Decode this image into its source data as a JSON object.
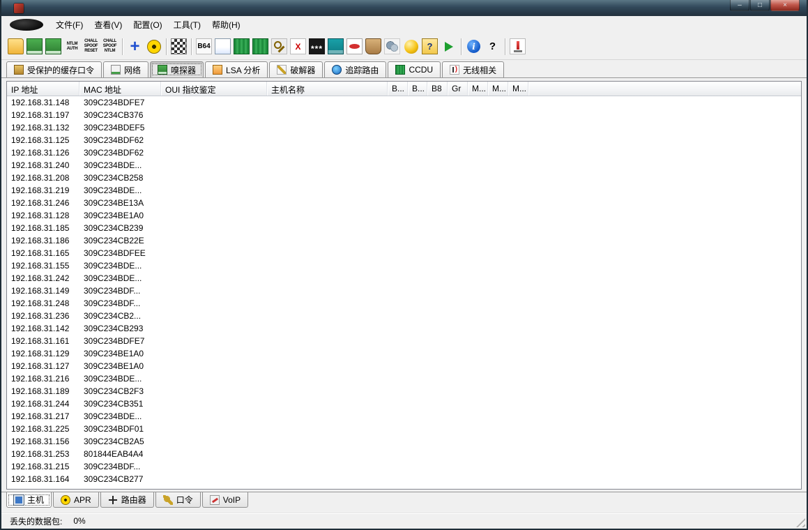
{
  "menubar": {
    "items": [
      "文件(F)",
      "查看(V)",
      "配置(O)",
      "工具(T)",
      "帮助(H)"
    ]
  },
  "toolbar": {
    "items": [
      {
        "name": "open-file",
        "type": "folder"
      },
      {
        "name": "start-stop-sniffer",
        "type": "nic"
      },
      {
        "name": "sniffer-options",
        "type": "nic"
      },
      {
        "name": "ntlm-auth",
        "type": "tinytext",
        "text": "NTLM\nAUTH"
      },
      {
        "name": "chall-spoof-reset",
        "type": "tinytext",
        "text": "CHALL\nSPOOF\nRESET"
      },
      {
        "name": "chall-spoof-ntlm",
        "type": "tinytext",
        "text": "CHALL\nSPOOF\nNTLM"
      },
      {
        "type": "sep"
      },
      {
        "name": "add-to-list",
        "type": "plus",
        "text": "+"
      },
      {
        "name": "start-stop-apr",
        "type": "radiation"
      },
      {
        "type": "sep"
      },
      {
        "name": "filter-grid",
        "type": "grid"
      },
      {
        "type": "sep"
      },
      {
        "name": "base64-decoder",
        "type": "b64",
        "text": "B64"
      },
      {
        "name": "file-editor",
        "type": "page"
      },
      {
        "name": "hash-calculator",
        "type": "hex"
      },
      {
        "name": "hash-calculator-2",
        "type": "hex"
      },
      {
        "name": "rsa-key",
        "type": "key"
      },
      {
        "name": "certificate-x",
        "type": "xc",
        "text": "X"
      },
      {
        "name": "asterisk-revealer",
        "type": "stars",
        "text": "***"
      },
      {
        "name": "calculator",
        "type": "calc"
      },
      {
        "name": "securid-token",
        "type": "securid"
      },
      {
        "name": "wallet",
        "type": "purse"
      },
      {
        "name": "services",
        "type": "gears"
      },
      {
        "name": "remote-sphere",
        "type": "sphere"
      },
      {
        "name": "wizard",
        "type": "wizard",
        "text": "?"
      },
      {
        "name": "audio-player",
        "type": "speaker"
      },
      {
        "type": "sep"
      },
      {
        "name": "info",
        "type": "info",
        "text": "i"
      },
      {
        "name": "help",
        "type": "help",
        "text": "?"
      },
      {
        "type": "sep"
      },
      {
        "name": "abel-injector",
        "type": "injector"
      }
    ]
  },
  "mode_tabs": [
    {
      "name": "protected-storage",
      "icon": "protected-storage-icon",
      "label": "受保护的缓存口令",
      "active": false
    },
    {
      "name": "network",
      "icon": "network-icon",
      "label": "网络",
      "active": false
    },
    {
      "name": "sniffer",
      "icon": "sniffer-icon",
      "label": "嗅探器",
      "active": true
    },
    {
      "name": "lsa-secrets",
      "icon": "lsa-secrets-icon",
      "label": "LSA 分析",
      "active": false
    },
    {
      "name": "cracker",
      "icon": "cracker-icon",
      "label": "破解器",
      "active": false
    },
    {
      "name": "traceroute",
      "icon": "traceroute-icon",
      "label": "追踪路由",
      "active": false
    },
    {
      "name": "ccdu",
      "icon": "ccdu-icon",
      "label": "CCDU",
      "active": false
    },
    {
      "name": "wireless",
      "icon": "wireless-icon",
      "label": "无线相关",
      "active": false
    }
  ],
  "table": {
    "columns": [
      "IP 地址",
      "MAC 地址",
      "OUI 指纹鉴定",
      "主机名称",
      "B...",
      "B...",
      "B8",
      "Gr",
      "M...",
      "M...",
      "M..."
    ],
    "rows": [
      {
        "ip": "192.168.31.148",
        "mac": "309C234BDFE7"
      },
      {
        "ip": "192.168.31.197",
        "mac": "309C234CB376"
      },
      {
        "ip": "192.168.31.132",
        "mac": "309C234BDEF5"
      },
      {
        "ip": "192.168.31.125",
        "mac": "309C234BDF62"
      },
      {
        "ip": "192.168.31.126",
        "mac": "309C234BDF62"
      },
      {
        "ip": "192.168.31.240",
        "mac": "309C234BDE..."
      },
      {
        "ip": "192.168.31.208",
        "mac": "309C234CB258"
      },
      {
        "ip": "192.168.31.219",
        "mac": "309C234BDE..."
      },
      {
        "ip": "192.168.31.246",
        "mac": "309C234BE13A"
      },
      {
        "ip": "192.168.31.128",
        "mac": "309C234BE1A0"
      },
      {
        "ip": "192.168.31.185",
        "mac": "309C234CB239"
      },
      {
        "ip": "192.168.31.186",
        "mac": "309C234CB22E"
      },
      {
        "ip": "192.168.31.165",
        "mac": "309C234BDFEE"
      },
      {
        "ip": "192.168.31.155",
        "mac": "309C234BDE..."
      },
      {
        "ip": "192.168.31.242",
        "mac": "309C234BDE..."
      },
      {
        "ip": "192.168.31.149",
        "mac": "309C234BDF..."
      },
      {
        "ip": "192.168.31.248",
        "mac": "309C234BDF..."
      },
      {
        "ip": "192.168.31.236",
        "mac": "309C234CB2..."
      },
      {
        "ip": "192.168.31.142",
        "mac": "309C234CB293"
      },
      {
        "ip": "192.168.31.161",
        "mac": "309C234BDFE7"
      },
      {
        "ip": "192.168.31.129",
        "mac": "309C234BE1A0"
      },
      {
        "ip": "192.168.31.127",
        "mac": "309C234BE1A0"
      },
      {
        "ip": "192.168.31.216",
        "mac": "309C234BDE..."
      },
      {
        "ip": "192.168.31.189",
        "mac": "309C234CB2F3"
      },
      {
        "ip": "192.168.31.244",
        "mac": "309C234CB351"
      },
      {
        "ip": "192.168.31.217",
        "mac": "309C234BDE..."
      },
      {
        "ip": "192.168.31.225",
        "mac": "309C234BDF01"
      },
      {
        "ip": "192.168.31.156",
        "mac": "309C234CB2A5"
      },
      {
        "ip": "192.168.31.253",
        "mac": "801844EAB4A4"
      },
      {
        "ip": "192.168.31.215",
        "mac": "309C234BDF..."
      },
      {
        "ip": "192.168.31.164",
        "mac": "309C234CB277"
      }
    ]
  },
  "view_tabs": [
    {
      "name": "hosts",
      "icon": "hosts-icon",
      "label": "主机",
      "active": true
    },
    {
      "name": "apr",
      "icon": "apr-icon",
      "label": "APR",
      "active": false
    },
    {
      "name": "routing",
      "icon": "routing-icon",
      "label": "路由器",
      "active": false
    },
    {
      "name": "passwords",
      "icon": "passwords-icon",
      "label": "口令",
      "active": false
    },
    {
      "name": "voip",
      "icon": "voip-icon",
      "label": "VoIP",
      "active": false
    }
  ],
  "statusbar": {
    "label": "丢失的数据包:",
    "value": "0%"
  }
}
